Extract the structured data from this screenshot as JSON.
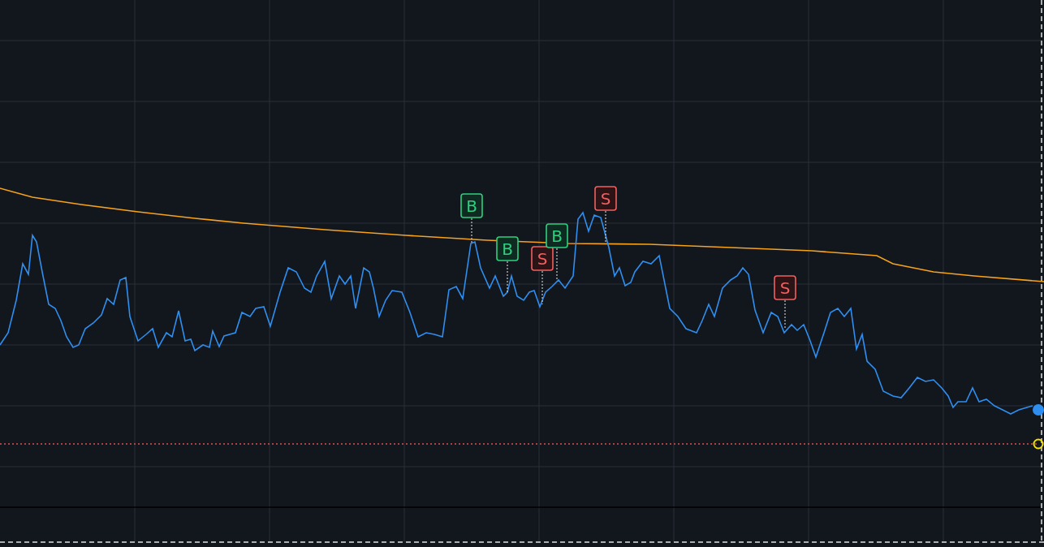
{
  "chart": {
    "markers": [
      {
        "label": "B",
        "kind": "buy"
      },
      {
        "label": "B",
        "kind": "buy"
      },
      {
        "label": "S",
        "kind": "sell"
      },
      {
        "label": "B",
        "kind": "buy"
      },
      {
        "label": "S",
        "kind": "sell"
      },
      {
        "label": "S",
        "kind": "sell"
      }
    ]
  }
}
